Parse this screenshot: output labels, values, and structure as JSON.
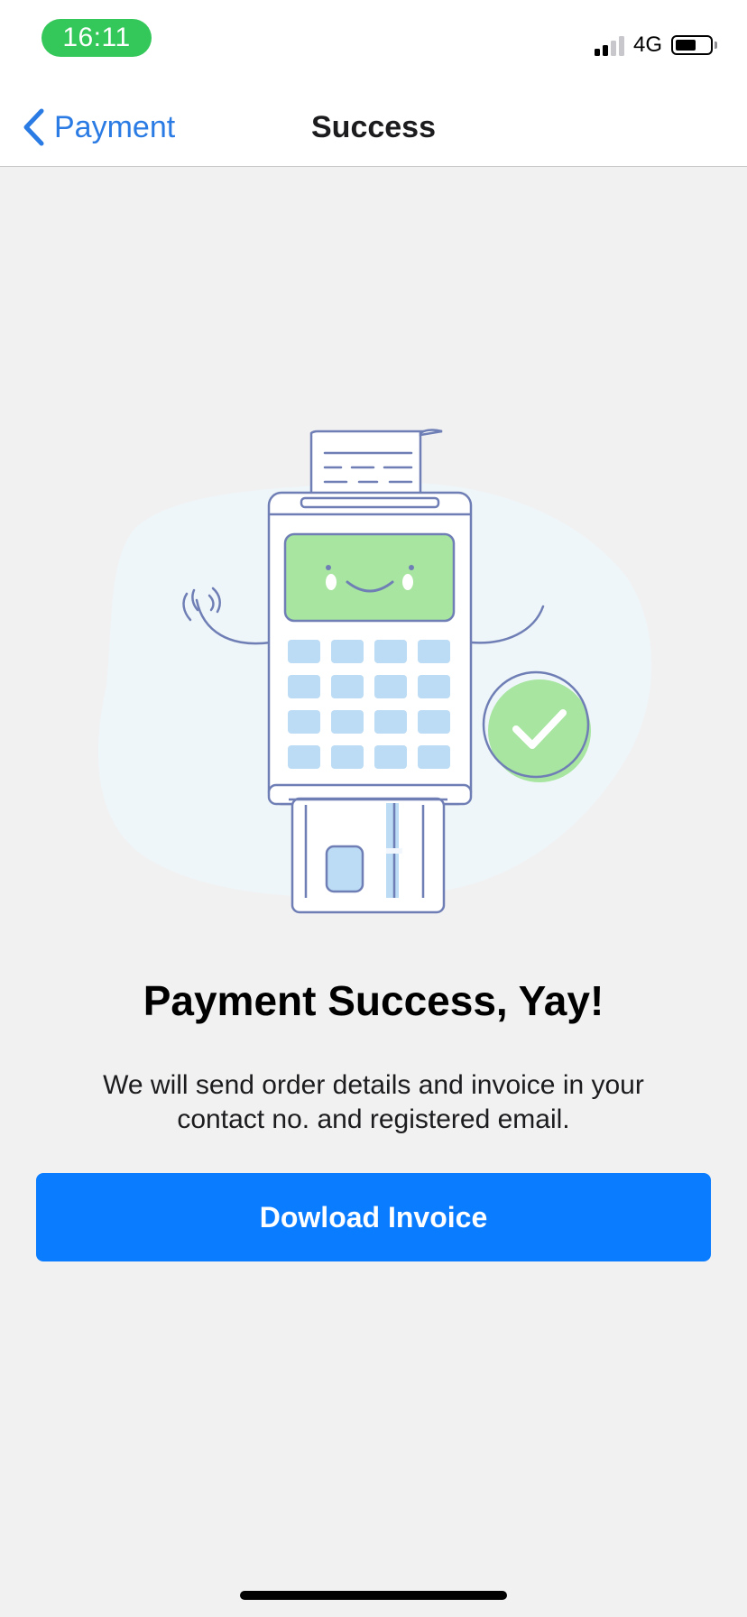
{
  "status_bar": {
    "time": "16:11",
    "network": "4G",
    "signal_level": 2,
    "signal_max": 4,
    "battery_level": 0.6
  },
  "nav": {
    "back_label": "Payment",
    "title": "Success"
  },
  "main": {
    "heading": "Payment Success, Yay!",
    "message": "We will send order details and invoice in your contact no. and registered email.",
    "button_label": "Dowload Invoice"
  },
  "colors": {
    "accent": "#0a7cff",
    "back_link": "#2b7be4",
    "success_green": "#a7e5a1",
    "time_pill": "#34c759",
    "illustration_line": "#6f7fb5",
    "keypad": "#bcdcf5",
    "background": "#f1f1f2"
  },
  "icons": {
    "back": "chevron-left-icon",
    "success": "check-circle-icon",
    "battery": "battery-icon",
    "signal": "signal-icon"
  }
}
